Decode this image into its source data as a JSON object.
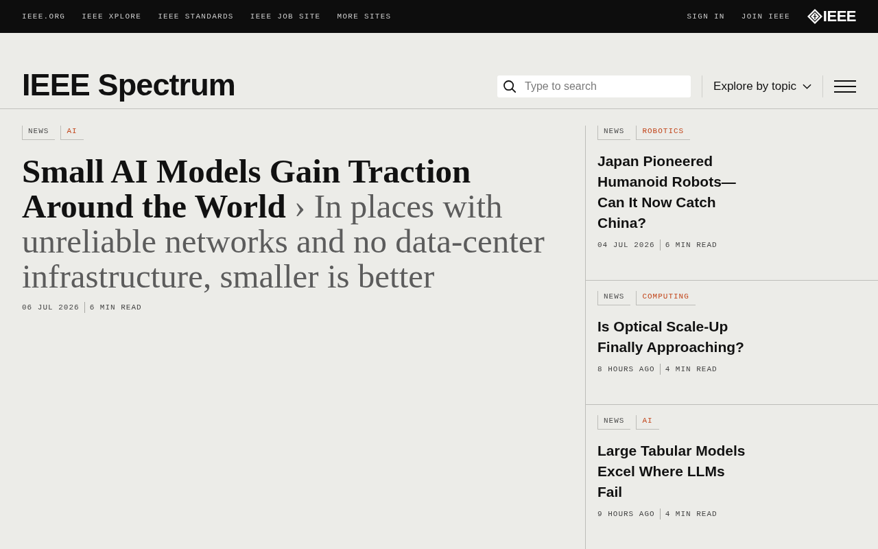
{
  "top_bar": {
    "links": [
      "IEEE.ORG",
      "IEEE XPLORE",
      "IEEE STANDARDS",
      "IEEE JOB SITE",
      "MORE SITES"
    ],
    "account_links": [
      "SIGN IN",
      "JOIN IEEE"
    ],
    "brand": "IEEE"
  },
  "header": {
    "logo": "IEEE Spectrum",
    "search": {
      "placeholder": "Type to search"
    },
    "explore_button": "Explore by topic"
  },
  "lead_article": {
    "tags": [
      {
        "label": "NEWS",
        "kind": "section"
      },
      {
        "label": "AI",
        "kind": "topic"
      }
    ],
    "headline": "**Small AI Models Gain Traction Around the World** › In places with unreliable networks and no data-center infrastructure, smaller is better",
    "published": "06 JUL 2026",
    "read_time": "6 MIN READ"
  },
  "side_articles": [
    {
      "tags": [
        {
          "label": "NEWS",
          "kind": "section"
        },
        {
          "label": "ROBOTICS",
          "kind": "topic"
        }
      ],
      "title": "Japan Pioneered Humanoid Robots—Can It Now Catch China?",
      "published": "04 JUL 2026",
      "read_time": "6 MIN READ"
    },
    {
      "tags": [
        {
          "label": "NEWS",
          "kind": "section"
        },
        {
          "label": "COMPUTING",
          "kind": "topic"
        }
      ],
      "title": "Is Optical Scale-Up Finally Approaching?",
      "published": "8 HOURS AGO",
      "read_time": "4 MIN READ"
    },
    {
      "tags": [
        {
          "label": "NEWS",
          "kind": "section"
        },
        {
          "label": "AI",
          "kind": "topic"
        }
      ],
      "title": "Large Tabular Models Excel Where LLMs Fail",
      "published": "9 HOURS AGO",
      "read_time": "4 MIN READ"
    }
  ]
}
